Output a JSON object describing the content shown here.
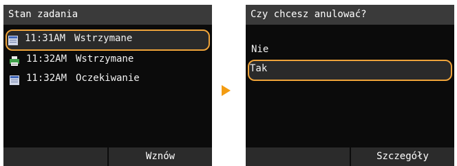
{
  "left_screen": {
    "title": "Stan zadania",
    "jobs": [
      {
        "time": "11:31AM",
        "status": "Wstrzymane",
        "icon": "document-icon",
        "selected": true
      },
      {
        "time": "11:32AM",
        "status": "Wstrzymane",
        "icon": "printer-icon",
        "selected": false
      },
      {
        "time": "11:32AM",
        "status": "Oczekiwanie",
        "icon": "document-icon",
        "selected": false
      }
    ],
    "softkey_right": "Wznów"
  },
  "transition_arrow": "arrow-right-icon",
  "right_screen": {
    "title": "Czy chcesz anulować?",
    "options": [
      {
        "label": "Nie",
        "selected": false
      },
      {
        "label": "Tak",
        "selected": true
      }
    ],
    "softkey_right": "Szczegóły"
  },
  "colors": {
    "highlight": "#f0a43a",
    "arrow": "#f39c12",
    "screen_bg": "#0b0b0b",
    "titlebar_bg": "#3a3a3a"
  }
}
